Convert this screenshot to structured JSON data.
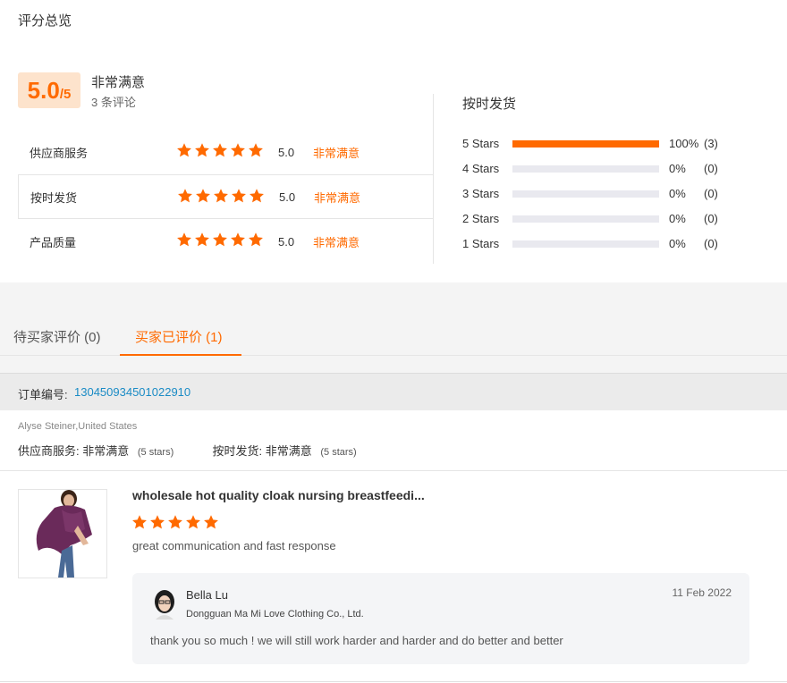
{
  "page_title": "评分总览",
  "overall": {
    "score": "5.0",
    "score_max": "/5",
    "label": "非常满意",
    "review_count": "3 条评论"
  },
  "categories": [
    {
      "name": "供应商服务",
      "stars": 5,
      "value": "5.0",
      "level": "非常满意"
    },
    {
      "name": "按时发货",
      "stars": 5,
      "value": "5.0",
      "level": "非常满意"
    },
    {
      "name": "产品质量",
      "stars": 5,
      "value": "5.0",
      "level": "非常满意"
    }
  ],
  "distribution": {
    "title": "按时发货",
    "rows": [
      {
        "label": "5 Stars",
        "percent": "100%",
        "count": "(3)",
        "fraction": 1.0
      },
      {
        "label": "4 Stars",
        "percent": "0%",
        "count": "(0)",
        "fraction": 0
      },
      {
        "label": "3 Stars",
        "percent": "0%",
        "count": "(0)",
        "fraction": 0
      },
      {
        "label": "2 Stars",
        "percent": "0%",
        "count": "(0)",
        "fraction": 0
      },
      {
        "label": "1 Stars",
        "percent": "0%",
        "count": "(0)",
        "fraction": 0
      }
    ]
  },
  "tabs": [
    {
      "label": "待买家评价 (0)",
      "active": false
    },
    {
      "label": "买家已评价 (1)",
      "active": true
    }
  ],
  "order": {
    "label": "订单编号:",
    "id": "130450934501022910"
  },
  "review": {
    "reviewer": "Alyse Steiner,United States",
    "sub_ratings": [
      {
        "name": "供应商服务:",
        "level": "非常满意",
        "stars_text": "(5 stars)"
      },
      {
        "name": "按时发货:",
        "level": "非常满意",
        "stars_text": "(5 stars)"
      }
    ],
    "product_title": "wholesale hot quality cloak nursing breastfeedi...",
    "stars": 5,
    "text": "great communication and fast response",
    "reply": {
      "name": "Bella Lu",
      "company": "Dongguan Ma Mi Love Clothing Co., Ltd.",
      "date": "11 Feb 2022",
      "text": "thank you so much ! we will still work harder and harder and do better and better"
    }
  },
  "colors": {
    "accent": "#ff6a00",
    "score_bg": "#fde3cc",
    "link": "#1a8bc5",
    "bar_empty": "#e9e9ef"
  }
}
